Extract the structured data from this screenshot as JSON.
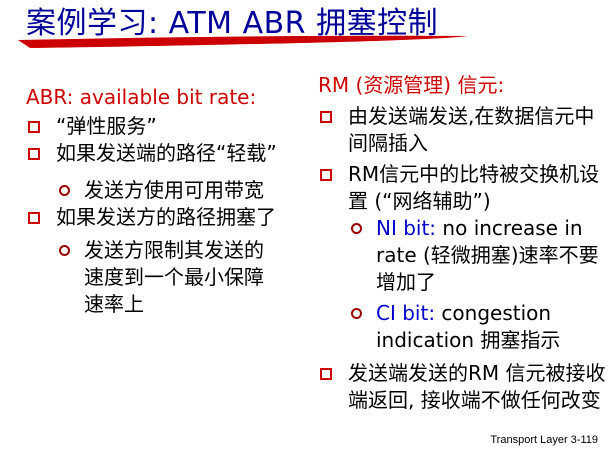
{
  "title": "案例学习: ATM ABR 拥塞控制",
  "left": {
    "heading": "ABR: available bit rate:",
    "items": [
      {
        "text": "“弹性服务”"
      },
      {
        "text": "如果发送端的路径“轻载”"
      },
      {
        "sub": "发送方使用可用带宽"
      },
      {
        "text": "如果发送方的路径拥塞了"
      },
      {
        "sub": "发送方限制其发送的速度到一个最小保障速率上"
      }
    ]
  },
  "right": {
    "heading": "RM (资源管理) 信元:",
    "item1": "由发送端发送,在数据信元中间隔插入",
    "item2": "RM信元中的比特被交换机设置 (“网络辅助”)",
    "ni_label": "NI bit:",
    "ni_text": "no increase in rate (轻微拥塞)速率不要增加了",
    "ci_label": "CI bit:",
    "ci_text": "congestion indication 拥塞指示",
    "item3": "发送端发送的RM 信元被接收端返回, 接收端不做任何改变"
  },
  "footer": "Transport Layer   3-119"
}
